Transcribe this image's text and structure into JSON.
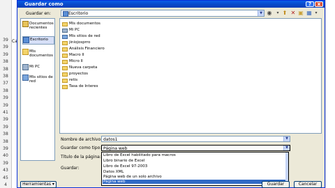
{
  "excel": {
    "row_numbers": [
      "",
      "",
      "",
      "",
      "",
      "39",
      "39",
      "39",
      "38",
      "38",
      "38",
      "37",
      "38",
      "39",
      "39",
      "41",
      "39",
      "39",
      "38",
      "38",
      "39",
      "40",
      "39",
      "43",
      "45",
      "4"
    ],
    "cell_fragment": "Ca"
  },
  "dialog": {
    "title": "Guardar como",
    "help_glyph": "?",
    "close_glyph": "x"
  },
  "toolbar": {
    "save_in_label": "Guardar en:",
    "location": "Escritorio"
  },
  "places": [
    {
      "label": "Documentos recientes",
      "icon": "recent-documents-icon"
    },
    {
      "label": "Escritorio",
      "icon": "desktop-icon",
      "selected": true
    },
    {
      "label": "Mis documentos",
      "icon": "my-documents-icon"
    },
    {
      "label": "Mi PC",
      "icon": "my-computer-icon"
    },
    {
      "label": "Mis sitios de red",
      "icon": "network-places-icon"
    }
  ],
  "files": [
    "Mis documentos",
    "Mi PC",
    "Mis sitios de red",
    "jiniojosprro",
    "Análisis Financiero",
    "Macro II",
    "Micro II",
    "Nueva carpeta",
    "proyectos",
    "retis",
    "Tasa de Interes"
  ],
  "fields": {
    "filename_label": "Nombre de archivo:",
    "filename_value": "datos1",
    "filetype_label": "Guardar como tipo:",
    "filetype_value": "Página web",
    "page_title_label": "Título de la página:",
    "save_label": "Guardar:"
  },
  "filetype_options": [
    "Libro de Excel habilitado para macros",
    "Libro binario de Excel",
    "Libro de Excel 97-2003",
    "Datos XML",
    "Página web de un solo archivo",
    "Página web"
  ],
  "buttons": {
    "tools": "Herramientas",
    "save": "Guardar",
    "cancel": "Cancelar"
  }
}
